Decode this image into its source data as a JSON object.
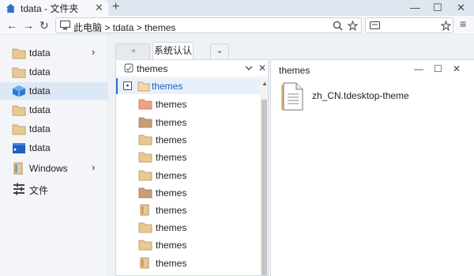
{
  "window": {
    "tab_title": "tdata - 文件夹",
    "tab_close": "✕",
    "new_tab": "+",
    "minimize": "—",
    "maximize": "☐",
    "close": "✕"
  },
  "nav": {
    "back": "←",
    "forward": "→",
    "refresh": "↻",
    "address": "此电脑 > tdata > themes",
    "menu": "≡"
  },
  "sidebar": {
    "items": [
      {
        "label": "tdata",
        "icon": "folder-icon",
        "chevron": "›"
      },
      {
        "label": "tdata",
        "icon": "folder-icon"
      },
      {
        "label": "tdata",
        "icon": "cube-icon"
      },
      {
        "label": "tdata",
        "icon": "folder-icon"
      },
      {
        "label": "tdata",
        "icon": "folder-icon"
      },
      {
        "label": "tdata",
        "icon": "window-folder-icon"
      },
      {
        "label": "Windows",
        "icon": "drive-icon",
        "chevron": "›"
      },
      {
        "label": "文件",
        "icon": "tools-icon"
      }
    ]
  },
  "inner_tabs": {
    "back_label": "◂",
    "active_label": "系统认认",
    "dropdown": "⌄"
  },
  "tree_pane": {
    "title": "themes",
    "root": {
      "label": "themes",
      "expander": "▪"
    },
    "items": [
      "themes",
      "themes",
      "themes",
      "themes",
      "themes",
      "themes",
      "themes",
      "themes",
      "themes",
      "themes"
    ]
  },
  "detail_pane": {
    "title": "themes",
    "files": [
      {
        "name": "zh_CN.tdesktop-theme",
        "icon": "document-icon"
      }
    ]
  },
  "colors": {
    "accent": "#2f6fd2",
    "folder": "#e8c992",
    "selected_bg": "#dde8f7"
  }
}
